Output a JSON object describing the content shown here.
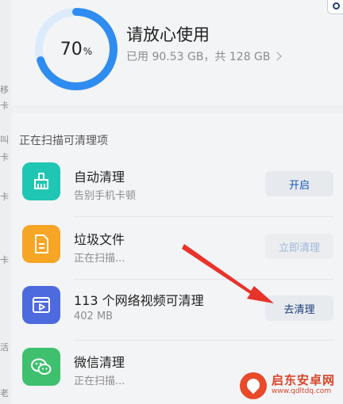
{
  "storage": {
    "percent": 70,
    "percent_number": "70",
    "percent_unit": "%",
    "title": "请放心使用",
    "subtitle": "已用 90.53 GB，共 128 GB",
    "ring_color": "#2f8cf0",
    "ring_track_color": "#dcebfb"
  },
  "section_label": "正在扫描可清理项",
  "items": [
    {
      "title": "自动清理",
      "subtitle": "告别手机卡顿",
      "button": "开启",
      "icon": "broom-icon",
      "icon_color": "#1fc6b3"
    },
    {
      "title": "垃圾文件",
      "subtitle": "正在扫描...",
      "button": "立即清理",
      "icon": "document-icon",
      "icon_color": "#f6a524"
    },
    {
      "title": "113 个网络视频可清理",
      "subtitle": "402 MB",
      "button": "去清理",
      "icon": "video-icon",
      "icon_color": "#4d6adf"
    },
    {
      "title": "微信清理",
      "subtitle": "正在扫描...",
      "button": "",
      "icon": "wechat-icon",
      "icon_color": "#3fc06e"
    }
  ],
  "annotation_color": "#e8322a",
  "watermark": {
    "name": "启东安卓网",
    "url": "www.qdltdq.com"
  }
}
